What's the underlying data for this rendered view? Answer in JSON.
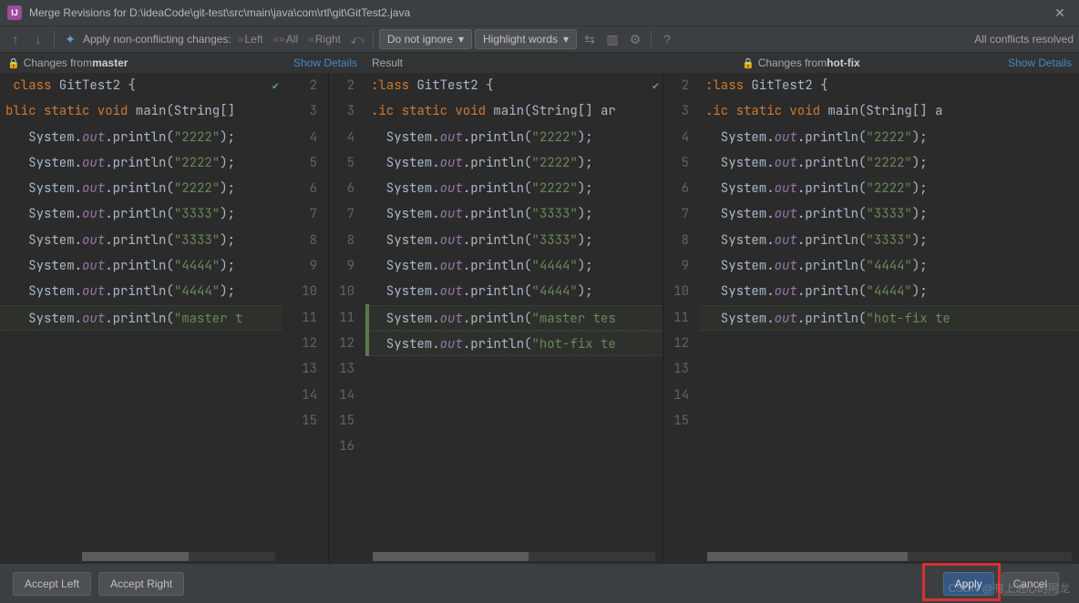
{
  "titlebar": {
    "title": "Merge Revisions for D:\\ideaCode\\git-test\\src\\main\\java\\com\\rtl\\git\\GitTest2.java"
  },
  "toolbar": {
    "apply_label": "Apply non-conflicting changes:",
    "left_btn": "Left",
    "all_btn": "All",
    "right_btn": "Right",
    "ignore_combo": "Do not ignore",
    "highlight_combo": "Highlight words",
    "status": "All conflicts resolved"
  },
  "subheaders": {
    "left_prefix": "Changes from ",
    "left_branch": "master",
    "show_details": "Show Details",
    "mid_label": "Result",
    "right_prefix": "Changes from ",
    "right_branch": "hot-fix"
  },
  "code": {
    "class_decl": " class GitTest2 {",
    "class_decl_mid": ":lass GitTest2 {",
    "class_decl_right": ":lass GitTest2 {",
    "main_left": "blic static void main(String[]",
    "main_mid": ".ic static void main(String[] ar",
    "main_right": ".ic static void main(String[] a",
    "p2222": "System.out.println(\"2222\");",
    "p3333": "System.out.println(\"3333\");",
    "p4444": "System.out.println(\"4444\");",
    "master_left": "System.out.println(\"master t",
    "master_mid": "System.out.println(\"master tes",
    "hotfix_mid": "System.out.println(\"hot-fix te",
    "hotfix_right": "System.out.println(\"hot-fix te"
  },
  "gutters": {
    "left": [
      "2",
      "3",
      "4",
      "5",
      "6",
      "7",
      "8",
      "9",
      "10",
      "11",
      "12",
      "13",
      "14",
      "15"
    ],
    "midL": [
      "2",
      "3",
      "4",
      "5",
      "6",
      "7",
      "8",
      "9",
      "10",
      "11",
      "12",
      "13",
      "14",
      "15",
      "16"
    ],
    "right": [
      "2",
      "3",
      "4",
      "5",
      "6",
      "7",
      "8",
      "9",
      "10",
      "11",
      "12",
      "13",
      "14",
      "15"
    ]
  },
  "footer": {
    "accept_left": "Accept Left",
    "accept_right": "Accept Right",
    "apply": "Apply",
    "cancel": "Cancel"
  },
  "watermark": "CSDN @有上进心的阿龙"
}
